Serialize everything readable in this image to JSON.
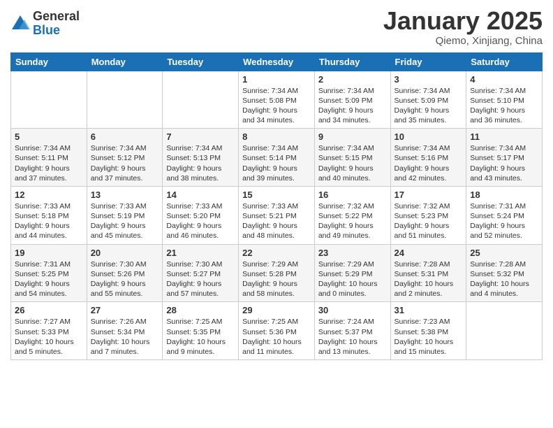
{
  "logo": {
    "general": "General",
    "blue": "Blue"
  },
  "title": "January 2025",
  "location": "Qiemo, Xinjiang, China",
  "headers": [
    "Sunday",
    "Monday",
    "Tuesday",
    "Wednesday",
    "Thursday",
    "Friday",
    "Saturday"
  ],
  "weeks": [
    [
      {
        "day": "",
        "info": ""
      },
      {
        "day": "",
        "info": ""
      },
      {
        "day": "",
        "info": ""
      },
      {
        "day": "1",
        "info": "Sunrise: 7:34 AM\nSunset: 5:08 PM\nDaylight: 9 hours\nand 34 minutes."
      },
      {
        "day": "2",
        "info": "Sunrise: 7:34 AM\nSunset: 5:09 PM\nDaylight: 9 hours\nand 34 minutes."
      },
      {
        "day": "3",
        "info": "Sunrise: 7:34 AM\nSunset: 5:09 PM\nDaylight: 9 hours\nand 35 minutes."
      },
      {
        "day": "4",
        "info": "Sunrise: 7:34 AM\nSunset: 5:10 PM\nDaylight: 9 hours\nand 36 minutes."
      }
    ],
    [
      {
        "day": "5",
        "info": "Sunrise: 7:34 AM\nSunset: 5:11 PM\nDaylight: 9 hours\nand 37 minutes."
      },
      {
        "day": "6",
        "info": "Sunrise: 7:34 AM\nSunset: 5:12 PM\nDaylight: 9 hours\nand 37 minutes."
      },
      {
        "day": "7",
        "info": "Sunrise: 7:34 AM\nSunset: 5:13 PM\nDaylight: 9 hours\nand 38 minutes."
      },
      {
        "day": "8",
        "info": "Sunrise: 7:34 AM\nSunset: 5:14 PM\nDaylight: 9 hours\nand 39 minutes."
      },
      {
        "day": "9",
        "info": "Sunrise: 7:34 AM\nSunset: 5:15 PM\nDaylight: 9 hours\nand 40 minutes."
      },
      {
        "day": "10",
        "info": "Sunrise: 7:34 AM\nSunset: 5:16 PM\nDaylight: 9 hours\nand 42 minutes."
      },
      {
        "day": "11",
        "info": "Sunrise: 7:34 AM\nSunset: 5:17 PM\nDaylight: 9 hours\nand 43 minutes."
      }
    ],
    [
      {
        "day": "12",
        "info": "Sunrise: 7:33 AM\nSunset: 5:18 PM\nDaylight: 9 hours\nand 44 minutes."
      },
      {
        "day": "13",
        "info": "Sunrise: 7:33 AM\nSunset: 5:19 PM\nDaylight: 9 hours\nand 45 minutes."
      },
      {
        "day": "14",
        "info": "Sunrise: 7:33 AM\nSunset: 5:20 PM\nDaylight: 9 hours\nand 46 minutes."
      },
      {
        "day": "15",
        "info": "Sunrise: 7:33 AM\nSunset: 5:21 PM\nDaylight: 9 hours\nand 48 minutes."
      },
      {
        "day": "16",
        "info": "Sunrise: 7:32 AM\nSunset: 5:22 PM\nDaylight: 9 hours\nand 49 minutes."
      },
      {
        "day": "17",
        "info": "Sunrise: 7:32 AM\nSunset: 5:23 PM\nDaylight: 9 hours\nand 51 minutes."
      },
      {
        "day": "18",
        "info": "Sunrise: 7:31 AM\nSunset: 5:24 PM\nDaylight: 9 hours\nand 52 minutes."
      }
    ],
    [
      {
        "day": "19",
        "info": "Sunrise: 7:31 AM\nSunset: 5:25 PM\nDaylight: 9 hours\nand 54 minutes."
      },
      {
        "day": "20",
        "info": "Sunrise: 7:30 AM\nSunset: 5:26 PM\nDaylight: 9 hours\nand 55 minutes."
      },
      {
        "day": "21",
        "info": "Sunrise: 7:30 AM\nSunset: 5:27 PM\nDaylight: 9 hours\nand 57 minutes."
      },
      {
        "day": "22",
        "info": "Sunrise: 7:29 AM\nSunset: 5:28 PM\nDaylight: 9 hours\nand 58 minutes."
      },
      {
        "day": "23",
        "info": "Sunrise: 7:29 AM\nSunset: 5:29 PM\nDaylight: 10 hours\nand 0 minutes."
      },
      {
        "day": "24",
        "info": "Sunrise: 7:28 AM\nSunset: 5:31 PM\nDaylight: 10 hours\nand 2 minutes."
      },
      {
        "day": "25",
        "info": "Sunrise: 7:28 AM\nSunset: 5:32 PM\nDaylight: 10 hours\nand 4 minutes."
      }
    ],
    [
      {
        "day": "26",
        "info": "Sunrise: 7:27 AM\nSunset: 5:33 PM\nDaylight: 10 hours\nand 5 minutes."
      },
      {
        "day": "27",
        "info": "Sunrise: 7:26 AM\nSunset: 5:34 PM\nDaylight: 10 hours\nand 7 minutes."
      },
      {
        "day": "28",
        "info": "Sunrise: 7:25 AM\nSunset: 5:35 PM\nDaylight: 10 hours\nand 9 minutes."
      },
      {
        "day": "29",
        "info": "Sunrise: 7:25 AM\nSunset: 5:36 PM\nDaylight: 10 hours\nand 11 minutes."
      },
      {
        "day": "30",
        "info": "Sunrise: 7:24 AM\nSunset: 5:37 PM\nDaylight: 10 hours\nand 13 minutes."
      },
      {
        "day": "31",
        "info": "Sunrise: 7:23 AM\nSunset: 5:38 PM\nDaylight: 10 hours\nand 15 minutes."
      },
      {
        "day": "",
        "info": ""
      }
    ]
  ]
}
